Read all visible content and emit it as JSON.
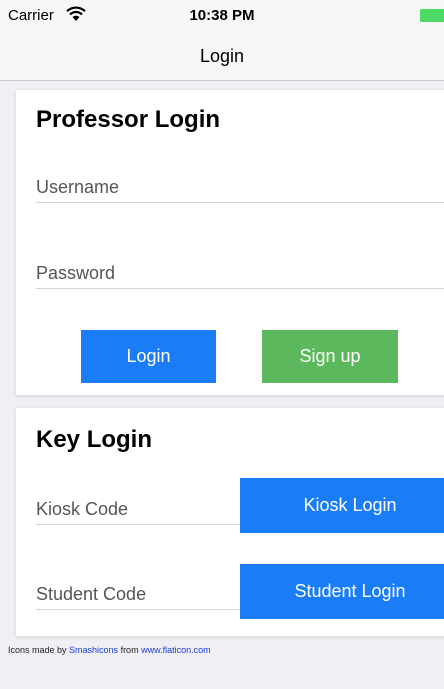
{
  "status_bar": {
    "carrier": "Carrier",
    "time": "10:38 PM",
    "battery_color": "#4cd964"
  },
  "nav": {
    "title": "Login"
  },
  "professor": {
    "title": "Professor Login",
    "username_placeholder": "Username",
    "username_value": "",
    "password_placeholder": "Password",
    "password_value": "",
    "login_label": "Login",
    "signup_label": "Sign up"
  },
  "key": {
    "title": "Key Login",
    "kiosk_placeholder": "Kiosk Code",
    "kiosk_value": "",
    "kiosk_button_label": "Kiosk Login",
    "student_placeholder": "Student Code",
    "student_value": "",
    "student_button_label": "Student Login"
  },
  "footer": {
    "prefix": "Icons made by ",
    "author": "Smashicons",
    "middle": " from ",
    "site": "www.flaticon.com"
  },
  "colors": {
    "primary_blue": "#1a7cf7",
    "signup_green": "#5cb85c",
    "background": "#efeff4"
  }
}
